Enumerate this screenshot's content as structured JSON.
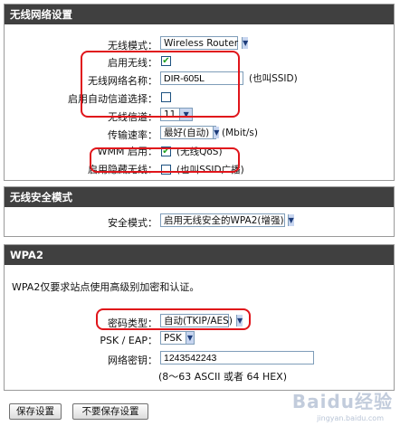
{
  "wireless_settings": {
    "header": "无线网络设置",
    "mode_label": "无线模式：",
    "mode_value": "Wireless Router",
    "enable_label": "启用无线：",
    "enable_checked": true,
    "ssid_label": "无线网络名称：",
    "ssid_value": "DIR-605L",
    "ssid_note": "(也叫SSID)",
    "auto_channel_label": "启用自动信道选择：",
    "auto_channel_checked": false,
    "channel_label": "无线信道：",
    "channel_value": "11",
    "rate_label": "传输速率：",
    "rate_value": "最好(自动)",
    "rate_unit": "(Mbit/s)",
    "wmm_label": "WMM 启用：",
    "wmm_checked": true,
    "wmm_note": "(无线QoS)",
    "hidden_label": "启用隐藏无线：",
    "hidden_checked": false,
    "hidden_note": "(也叫SSID广播)"
  },
  "security_mode": {
    "header": "无线安全模式",
    "mode_label": "安全模式：",
    "mode_value": "启用无线安全的WPA2(增强)"
  },
  "wpa2": {
    "header": "WPA2",
    "description": "WPA2仅要求站点使用高级别加密和认证。",
    "cipher_label": "密码类型：",
    "cipher_value": "自动(TKIP/AES)",
    "psk_label": "PSK / EAP：",
    "psk_value": "PSK",
    "key_label": "网络密钥：",
    "key_value": "1243542243",
    "key_hint": "(8～63 ASCII 或者 64 HEX)"
  },
  "buttons": {
    "save": "保存设置",
    "discard": "不要保存设置"
  },
  "watermark": {
    "brand": "Baidu经验",
    "url": "jingyan.baidu.com"
  },
  "colors": {
    "header_bg": "#404040",
    "highlight": "#e0151b",
    "check": "#21a121"
  }
}
